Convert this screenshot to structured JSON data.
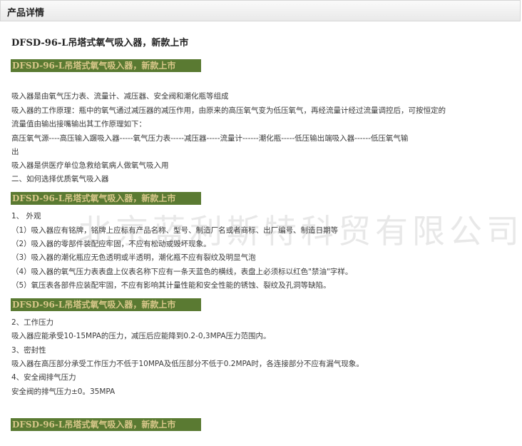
{
  "header": {
    "title": "产品详情"
  },
  "product_title": "DFSD-96-L吊塔式氧气吸入器，新款上市",
  "banner_text": "DFSD-96-L吊塔式氧气吸入器，新款上市",
  "watermark": "北京蓝利斯特科贸有限公司",
  "intro": [
    "吸入器是由氧气压力表、流量计、减压器、安全阀和潮化瓶等组成",
    "吸入器的工作原理：瓶中的氧气通过减压器的减压作用，由原来的高压氧气变为低压氧气，再经流量计经过流量调控后，可按恒定的",
    "流量值由输出接嘴输出其工作原理如下：",
    "高压氧气源----高压输入蹍吸入器-----氧气压力表-----减压器-----流量计------潮化瓶-----低压输出端吸入器------低压氧气输",
    "出",
    "吸入器是供医疗单位急救给氧病人做氧气吸入用",
    "二、如何选择优质氧气吸入器"
  ],
  "section1": [
    "1、  外观",
    "（1）吸入器应有铭牌，铭牌上应标有产品名称、型号、制造厂名或者商标、出厂编号、制造日期等",
    "（2）吸入器的零部件装配应牢固，不应有松动或毁坏现象。",
    "（3）吸入器的潮化瓶应无色透明或半透明，潮化瓶不应有裂纹及明显气泡",
    "（4）吸入器的氧气压力表表盘上仪表名称下应有一条天蓝色的横线，表盘上必须标以红色\"禁油\"字样。",
    "（5）氧压表各部件应装配牢固，不应有影响其计量性能和安全性能的锈蚀、裂纹及孔洞等缺陷。"
  ],
  "section2": [
    "2、工作压力",
    "吸入器应能承受10-15MPA的压力，减压后应能降到0.2-0,3MPA压力范围内。",
    "3、密封性",
    "吸入器在高压部分承受工作压力不低于10MPA及低压部分不低于0.2MPA时，各连接部分不应有漏气现象。",
    "4、安全阀排气压力",
    "安全阀的排气压力±0。35MPA"
  ]
}
